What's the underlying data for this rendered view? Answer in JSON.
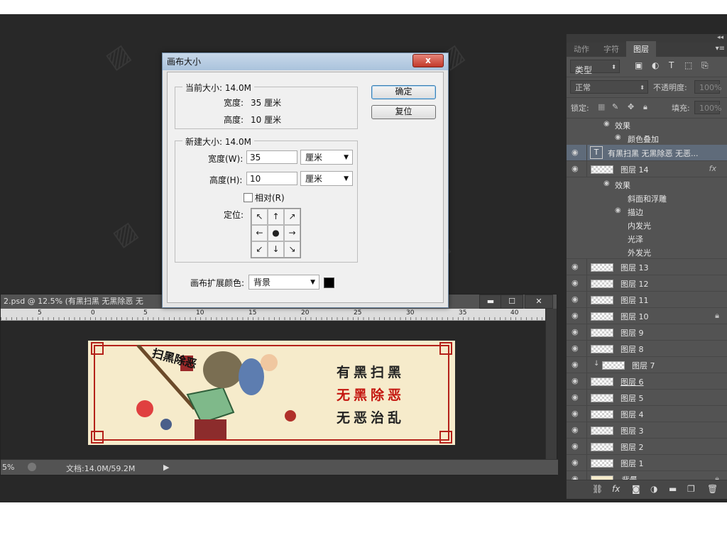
{
  "panel": {
    "tabs": [
      "动作",
      "字符",
      "图层"
    ],
    "filter_kind": "类型",
    "blend_mode": "正常",
    "opacity_label": "不透明度:",
    "opacity_value": "100%",
    "lock_label": "锁定:",
    "fill_label": "填充:",
    "fill_value": "100%",
    "top_effects": [
      {
        "label": "效果"
      },
      {
        "label": "颜色叠加"
      }
    ],
    "text_layer": "有黑扫黑 无黑除恶 无恶...",
    "layer14": {
      "name": "图层 14",
      "fx": "fx"
    },
    "layer14_effects": [
      "效果",
      "斜面和浮雕",
      "描边",
      "内发光",
      "光泽",
      "外发光"
    ],
    "layers": [
      {
        "name": "图层 13"
      },
      {
        "name": "图层 12"
      },
      {
        "name": "图层 11"
      },
      {
        "name": "图层 10"
      },
      {
        "name": "图层 9"
      },
      {
        "name": "图层 8"
      },
      {
        "name": "图层 7"
      },
      {
        "name": "图层 6"
      },
      {
        "name": "图层 5"
      },
      {
        "name": "图层 4"
      },
      {
        "name": "图层 3"
      },
      {
        "name": "图层 2"
      },
      {
        "name": "图层 1"
      }
    ],
    "background_layer": "背景"
  },
  "document": {
    "title": "2.psd @ 12.5% (有黑扫黑 无黑除恶 无",
    "ruler_ticks": [
      "5",
      "0",
      "5",
      "10",
      "15",
      "20",
      "25",
      "30",
      "35",
      "40"
    ],
    "zoom": "5%",
    "doc_info": "文档:14.0M/59.2M",
    "slogans": [
      "有黑扫黑",
      "无黑除恶",
      "无恶治乱"
    ],
    "art_text": "扫黑除恶"
  },
  "dialog": {
    "title": "画布大小",
    "current_legend": "当前大小: 14.0M",
    "current_width_label": "宽度:",
    "current_width_value": "35 厘米",
    "current_height_label": "高度:",
    "current_height_value": "10 厘米",
    "new_legend": "新建大小: 14.0M",
    "width_label": "宽度(W):",
    "width_value": "35",
    "height_label": "高度(H):",
    "height_value": "10",
    "unit": "厘米",
    "relative_label": "相对(R)",
    "anchor_label": "定位:",
    "anchor_arrows": [
      "↖",
      "↑",
      "↗",
      "←",
      "●",
      "→",
      "↙",
      "↓",
      "↘"
    ],
    "ext_color_label": "画布扩展颜色:",
    "ext_color_value": "背景",
    "ok": "确定",
    "reset": "复位",
    "close": "x"
  }
}
